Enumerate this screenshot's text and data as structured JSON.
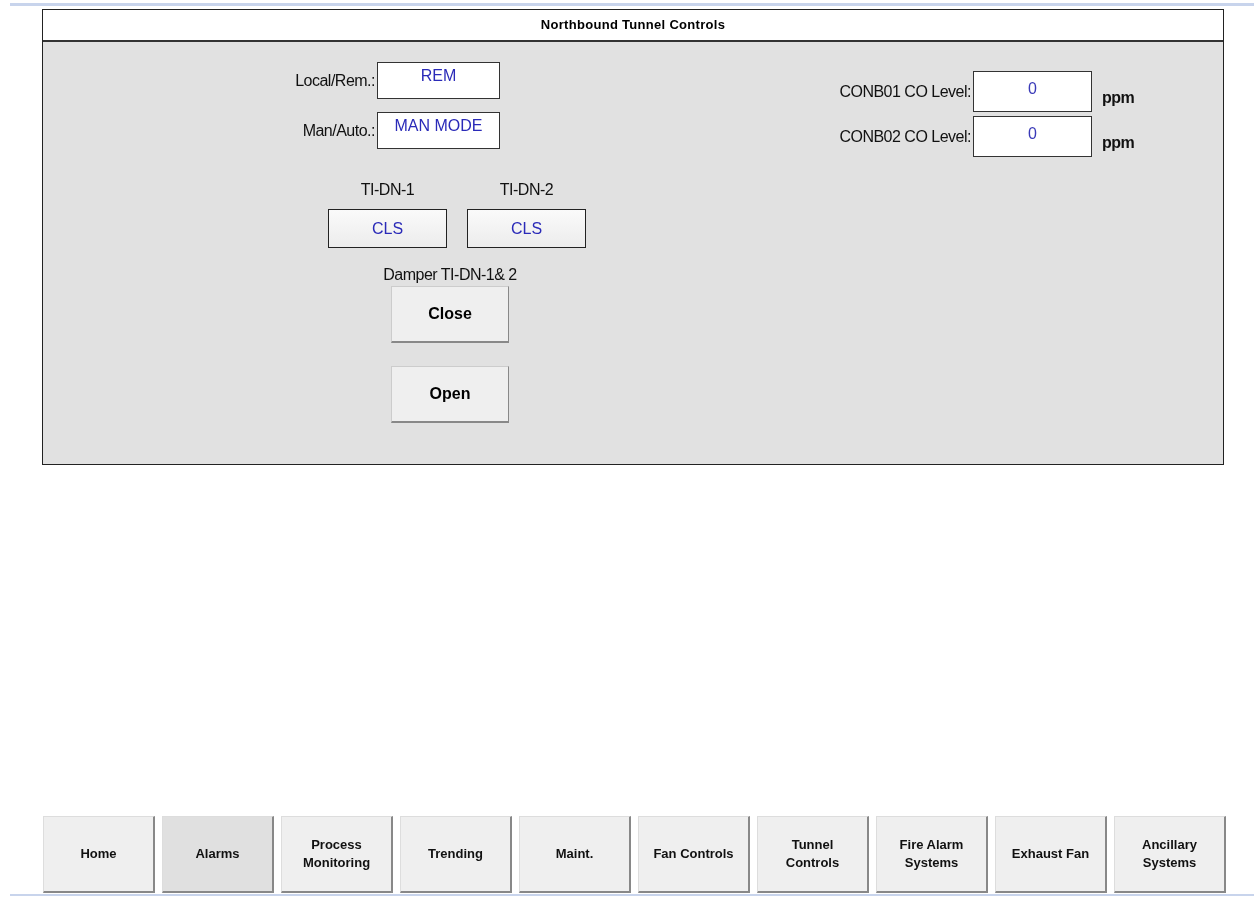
{
  "panel": {
    "title": "Northbound Tunnel Controls"
  },
  "mode_fields": [
    {
      "label": "Local/Rem.:",
      "value": "REM"
    },
    {
      "label": "Man/Auto.:",
      "value": "MAN MODE"
    }
  ],
  "dampers": [
    {
      "label": "TI-DN-1",
      "value": "CLS"
    },
    {
      "label": "TI-DN-2",
      "value": "CLS"
    }
  ],
  "damper_group": {
    "label": "Damper TI-DN-1& 2",
    "buttons": [
      "Close",
      "Open"
    ]
  },
  "co_levels": [
    {
      "label": "CONB01 CO Level:",
      "value": "0",
      "unit": "ppm"
    },
    {
      "label": "CONB02 CO Level:",
      "value": "0",
      "unit": "ppm"
    }
  ],
  "nav": [
    {
      "label": "Home",
      "selected": false
    },
    {
      "label": "Alarms",
      "selected": true
    },
    {
      "label": "Process\nMonitoring",
      "selected": false
    },
    {
      "label": "Trending",
      "selected": false
    },
    {
      "label": "Maint.",
      "selected": false
    },
    {
      "label": "Fan Controls",
      "selected": false
    },
    {
      "label": "Tunnel\nControls",
      "selected": false
    },
    {
      "label": "Fire Alarm\nSystems",
      "selected": false
    },
    {
      "label": "Exhaust Fan",
      "selected": false
    },
    {
      "label": "Ancillary\nSystems",
      "selected": false
    }
  ]
}
